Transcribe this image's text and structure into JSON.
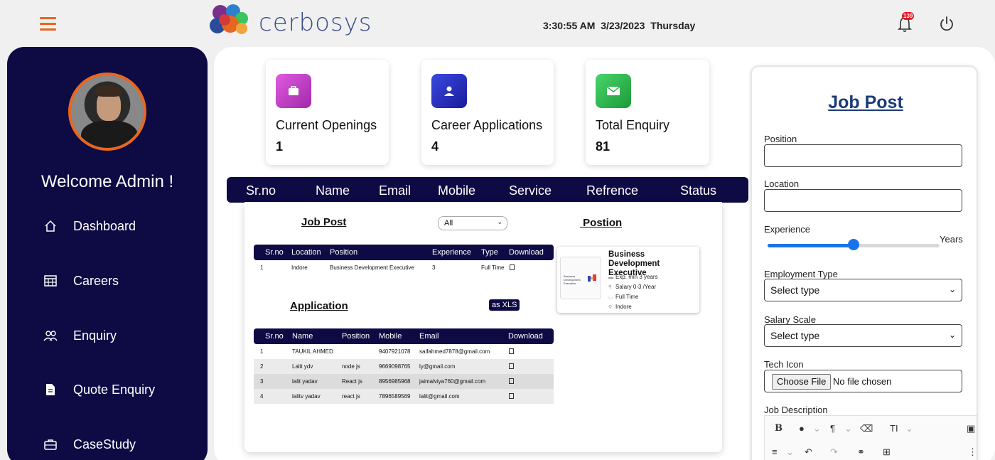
{
  "header": {
    "brand": "cerbosys",
    "time": "3:30:55 AM",
    "date": "3/23/2023",
    "weekday": "Thursday",
    "notification_count": "139"
  },
  "sidebar": {
    "welcome": "Welcome Admin !",
    "items": [
      {
        "label": "Dashboard",
        "icon": "home-icon"
      },
      {
        "label": "Careers",
        "icon": "table-icon"
      },
      {
        "label": "Enquiry",
        "icon": "users-icon"
      },
      {
        "label": "Quote Enquiry",
        "icon": "document-icon"
      },
      {
        "label": "CaseStudy",
        "icon": "briefcase-icon"
      }
    ]
  },
  "stats": [
    {
      "label": "Current Openings",
      "value": "1",
      "color": "#c53fc8",
      "icon": "briefcase-icon"
    },
    {
      "label": "Career Applications",
      "value": "4",
      "color": "#2a2fbf",
      "icon": "user-icon"
    },
    {
      "label": "Total Enquiry",
      "value": "81",
      "color": "#2fb54a",
      "icon": "mail-icon"
    }
  ],
  "enquiry_table": {
    "columns": [
      "Sr.no",
      "Name",
      "Email",
      "Mobile",
      "Service",
      "Refrence",
      "Status"
    ]
  },
  "careers": {
    "job_post_title": "Job Post",
    "filter_value": "All",
    "position_title": "Postion",
    "application_title": "Application",
    "export_label": "as XLS",
    "job_columns": [
      "Sr.no",
      "Location",
      "Position",
      "Experience",
      "Type",
      "Download"
    ],
    "job_rows": [
      {
        "sr": "1",
        "location": "Indore",
        "position": "Business Development Executive",
        "experience": "3",
        "type": "Full Time"
      }
    ],
    "app_columns": [
      "Sr.no",
      "Name",
      "Position",
      "Mobile",
      "Email",
      "Download"
    ],
    "app_rows": [
      {
        "sr": "1",
        "name": "TAUKIL AHMED",
        "position": "",
        "mobile": "9407921078",
        "email": "saifahmed7878@gmail.com"
      },
      {
        "sr": "2",
        "name": "Lalit ydv",
        "position": "node js",
        "mobile": "9669098765",
        "email": "ly@gmail.com"
      },
      {
        "sr": "3",
        "name": "lalit yadav",
        "position": "React js",
        "mobile": "8956985968",
        "email": "jaimalviya760@gmail.com"
      },
      {
        "sr": "4",
        "name": "lalitv yadav",
        "position": "react js",
        "mobile": "7896589569",
        "email": "lalit@gmail.com"
      }
    ],
    "position_card": {
      "title": "Business Development Executive",
      "thumb_text": "Business Development Executive",
      "experience": "Exp. min 3 years",
      "salary": "Salary 0-3 /Year",
      "type": "Full Time",
      "location": "Indore"
    }
  },
  "form": {
    "title": "Job Post",
    "position_label": "Position",
    "location_label": "Location",
    "experience_label": "Experience",
    "experience_unit": "Years",
    "experience_level": 0.5,
    "employment_label": "Employment Type",
    "employment_value": "Select type",
    "salary_label": "Salary Scale",
    "salary_value": "Select type",
    "tech_icon_label": "Tech Icon",
    "file_button": "Choose File",
    "file_status": "No file chosen",
    "description_label": "Job Description"
  },
  "colors": {
    "navy": "#0d0a44",
    "accent": "#e8671f",
    "link": "#1a3a7a",
    "slider": "#1a73e8"
  }
}
